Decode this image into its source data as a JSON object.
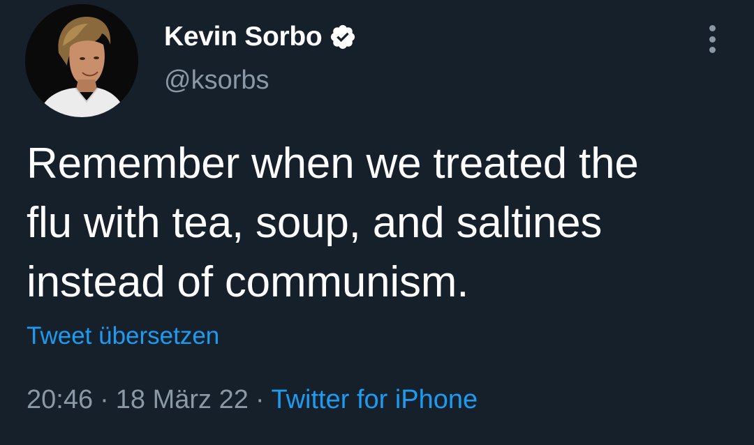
{
  "author": {
    "display_name": "Kevin Sorbo",
    "handle": "@ksorbs",
    "verified": true,
    "avatar": "profile-photo"
  },
  "tweet": {
    "lines": [
      "Remember when we treated the",
      "flu with tea, soup, and saltines",
      "instead of communism."
    ],
    "translate_label": "Tweet übersetzen"
  },
  "meta": {
    "time": "20:46",
    "separator": "·",
    "date": "18 März 22",
    "source": "Twitter for iPhone"
  },
  "icons": {
    "verified": "verified-badge-icon",
    "more": "more-options-icon"
  },
  "colors": {
    "background": "#15202b",
    "text": "#ffffff",
    "secondary": "#8b98a5",
    "accent": "#1d9bf0"
  }
}
